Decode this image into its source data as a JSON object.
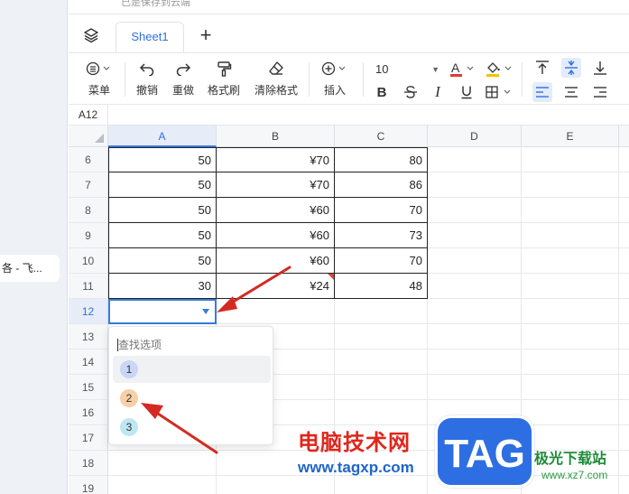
{
  "left_panel": {
    "doc_title": "各 - 飞..."
  },
  "top_strip": {
    "text": "已是保存到云端"
  },
  "tabs": {
    "sheet_name": "Sheet1",
    "add_label": "+"
  },
  "toolbar": {
    "menu": "菜单",
    "undo": "撤销",
    "redo": "重做",
    "format_painter": "格式刷",
    "clear_format": "清除格式",
    "insert": "插入",
    "font_size": "10"
  },
  "name_box": {
    "cell_ref": "A12"
  },
  "columns": [
    "A",
    "B",
    "C",
    "D",
    "E"
  ],
  "rows": [
    {
      "num": "6",
      "a": "50",
      "b": "¥70",
      "c": "80"
    },
    {
      "num": "7",
      "a": "50",
      "b": "¥70",
      "c": "86"
    },
    {
      "num": "8",
      "a": "50",
      "b": "¥60",
      "c": "70"
    },
    {
      "num": "9",
      "a": "50",
      "b": "¥60",
      "c": "73"
    },
    {
      "num": "10",
      "a": "50",
      "b": "¥60",
      "c": "70"
    },
    {
      "num": "11",
      "a": "30",
      "b": "¥24",
      "c": "48"
    },
    {
      "num": "12",
      "a": "",
      "b": "",
      "c": ""
    },
    {
      "num": "13",
      "a": "",
      "b": "",
      "c": ""
    },
    {
      "num": "14",
      "a": "",
      "b": "",
      "c": ""
    },
    {
      "num": "15",
      "a": "",
      "b": "",
      "c": ""
    },
    {
      "num": "16",
      "a": "",
      "b": "",
      "c": ""
    },
    {
      "num": "17",
      "a": "",
      "b": "",
      "c": ""
    },
    {
      "num": "18",
      "a": "",
      "b": "",
      "c": ""
    },
    {
      "num": "19",
      "a": "",
      "b": "",
      "c": ""
    }
  ],
  "dropdown": {
    "search_placeholder": "查找选项",
    "options": [
      {
        "label": "1",
        "color": "#c9d6f7"
      },
      {
        "label": "2",
        "color": "#f8cfa6"
      },
      {
        "label": "3",
        "color": "#bfe6f3"
      }
    ]
  },
  "watermark": {
    "title": "电脑技术网",
    "url": "www.tagxp.com",
    "tag": "TAG",
    "sub": "极光下载站",
    "url2": "www.xz7.com"
  },
  "colors": {
    "accent": "#3a7ae0",
    "arrow": "#d42a22",
    "comment_mark": "#d9463b"
  }
}
